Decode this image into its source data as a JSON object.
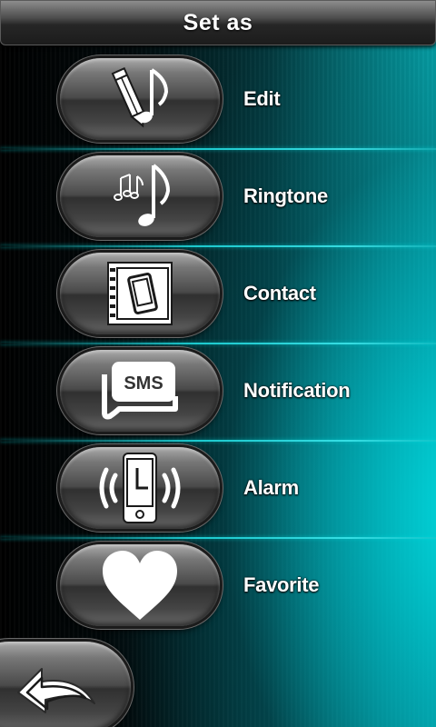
{
  "header": {
    "title": "Set as"
  },
  "menu": {
    "items": [
      {
        "label": "Edit",
        "icon": "edit-music-icon"
      },
      {
        "label": "Ringtone",
        "icon": "music-notes-icon"
      },
      {
        "label": "Contact",
        "icon": "contact-book-icon"
      },
      {
        "label": "Notification",
        "icon": "sms-icon"
      },
      {
        "label": "Alarm",
        "icon": "alarm-phone-icon"
      },
      {
        "label": "Favorite",
        "icon": "heart-icon"
      }
    ]
  },
  "footer": {
    "back_icon": "back-arrow-icon"
  },
  "colors": {
    "accent": "#00c8cf",
    "background": "#000000",
    "button": "#4a4a4a",
    "text": "#ffffff"
  }
}
